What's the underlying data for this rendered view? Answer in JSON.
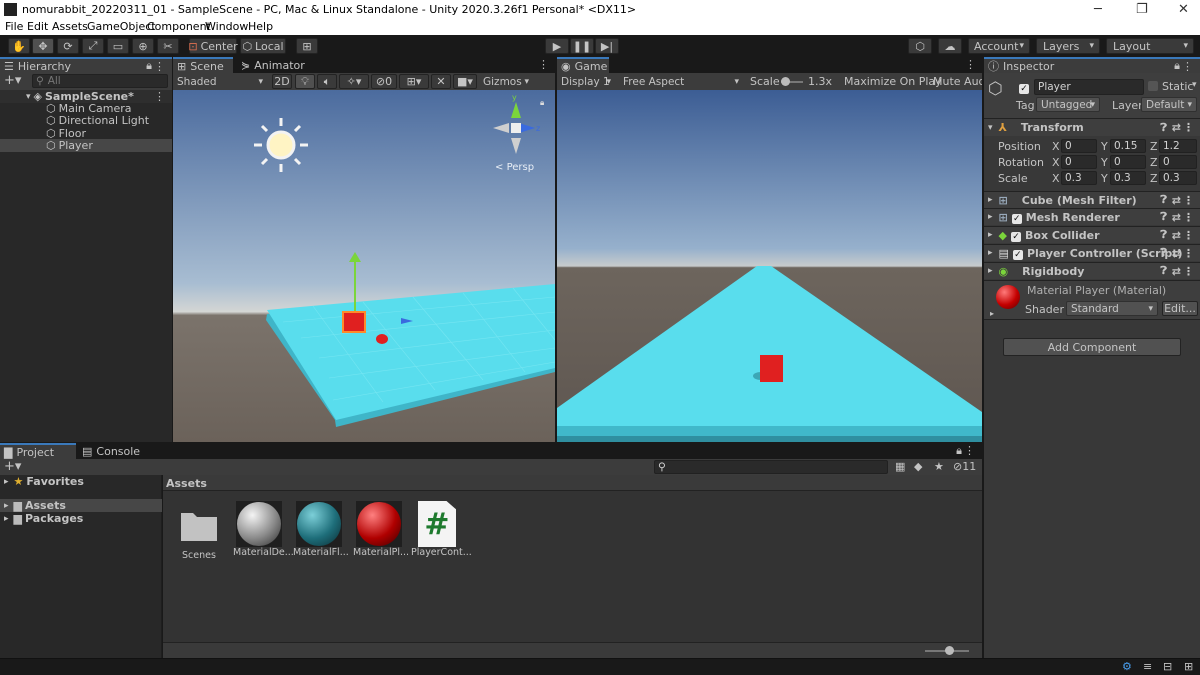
{
  "window": {
    "title": "nomurabbit_20220311_01 - SampleScene - PC, Mac & Linux Standalone - Unity 2020.3.26f1 Personal* <DX11>",
    "controls": [
      "─",
      "❐",
      "✕"
    ]
  },
  "menu": [
    "File",
    "Edit",
    "Assets",
    "GameObject",
    "Component",
    "Window",
    "Help"
  ],
  "toolbar": {
    "pivot": "Center",
    "space": "Local",
    "account": "Account",
    "layers": "Layers",
    "layout": "Layout"
  },
  "hierarchy": {
    "tab": "Hierarchy",
    "search_placeholder": "All",
    "scene": "SampleScene*",
    "items": [
      "Main Camera",
      "Directional Light",
      "Floor",
      "Player"
    ],
    "selected": "Player"
  },
  "scene_view": {
    "tabs": [
      "Scene",
      "Animator"
    ],
    "shading": "Shaded",
    "mode_2d": "2D",
    "gizmos": "Gizmos",
    "hidden_count": "0",
    "persp": "Persp"
  },
  "game_view": {
    "tab": "Game",
    "display": "Display 1",
    "aspect": "Free Aspect",
    "scale_label": "Scale",
    "scale_value": "1.3x",
    "slider_fraction": 0.1,
    "maximize": "Maximize On Play",
    "mute": "Mute Audi"
  },
  "inspector": {
    "tab": "Inspector",
    "object_name": "Player",
    "static_label": "Static",
    "tag_label": "Tag",
    "tag_value": "Untagged",
    "layer_label": "Layer",
    "layer_value": "Default",
    "transform": {
      "title": "Transform",
      "rows": [
        {
          "label": "Position",
          "x": "0",
          "y": "0.15",
          "z": "1.2"
        },
        {
          "label": "Rotation",
          "x": "0",
          "y": "0",
          "z": "0"
        },
        {
          "label": "Scale",
          "x": "0.3",
          "y": "0.3",
          "z": "0.3"
        }
      ]
    },
    "components": [
      {
        "name": "Cube (Mesh Filter)",
        "has_checkbox": false
      },
      {
        "name": "Mesh Renderer",
        "has_checkbox": true
      },
      {
        "name": "Box Collider",
        "has_checkbox": true
      },
      {
        "name": "Player Controller (Script)",
        "has_checkbox": true
      },
      {
        "name": "Rigidbody",
        "has_checkbox": false
      }
    ],
    "material": {
      "name": "Material Player (Material)",
      "shader_label": "Shader",
      "shader_value": "Standard",
      "edit": "Edit..."
    },
    "add_component": "Add Component"
  },
  "project": {
    "tabs": [
      "Project",
      "Console"
    ],
    "favorites": "Favorites",
    "tree": [
      "Assets",
      "Packages"
    ],
    "breadcrumb": "Assets",
    "hidden_count": "11",
    "assets": [
      {
        "label": "Scenes",
        "kind": "folder"
      },
      {
        "label": "MaterialDe...",
        "kind": "sphere-grey"
      },
      {
        "label": "MaterialFl...",
        "kind": "sphere-teal"
      },
      {
        "label": "MaterialPl...",
        "kind": "sphere-red"
      },
      {
        "label": "PlayerCont...",
        "kind": "script"
      }
    ]
  },
  "colors": {
    "floor": "#55e0f0",
    "player": "#e02020",
    "selection": "#2c5d87",
    "accent": "#3a79bb"
  }
}
